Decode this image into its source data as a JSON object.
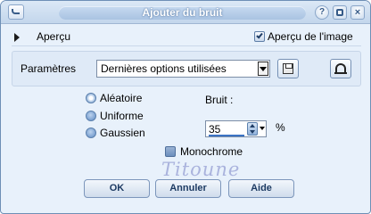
{
  "window": {
    "title": "Ajouter du bruit"
  },
  "titlebar": {
    "help_glyph": "?",
    "close_glyph": "×"
  },
  "preview": {
    "label": "Aperçu",
    "image_preview_label": "Aperçu de l'image",
    "image_preview_checked": true
  },
  "parameters": {
    "label": "Paramètres",
    "preset_value": "Dernières options utilisées"
  },
  "noise_type": {
    "options": [
      {
        "label": "Aléatoire",
        "selected": true
      },
      {
        "label": "Uniforme",
        "selected": false
      },
      {
        "label": "Gaussien",
        "selected": false
      }
    ]
  },
  "noise": {
    "label": "Bruit :",
    "value": "35",
    "unit": "%"
  },
  "monochrome": {
    "label": "Monochrome",
    "checked": false
  },
  "watermark": {
    "text": "Titoune"
  },
  "buttons": {
    "ok": "OK",
    "cancel": "Annuler",
    "help": "Aide"
  },
  "colors": {
    "frame": "#6e8fb6",
    "background": "#e8f1fb",
    "button_text": "#1d3b63",
    "accent": "#3b73c4"
  },
  "icons": [
    "system-menu-icon",
    "help-icon",
    "restore-icon",
    "close-icon",
    "expand-arrow-icon",
    "save-preset-icon",
    "reset-icon",
    "spin-arrows-icon",
    "dropdown-arrow-icon"
  ]
}
